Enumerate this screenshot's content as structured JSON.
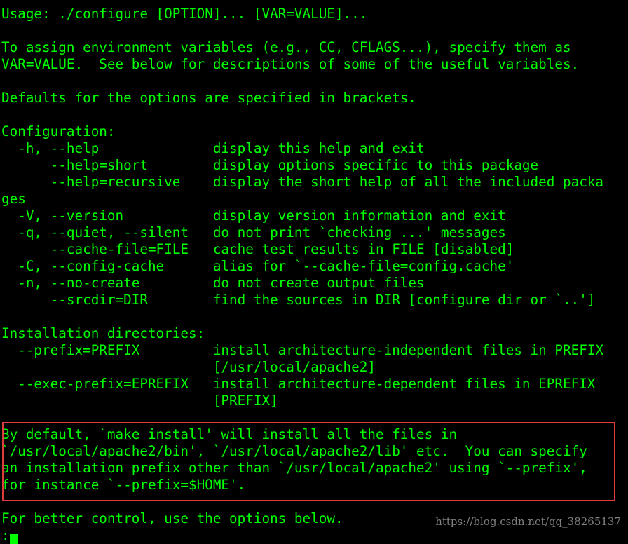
{
  "terminal": {
    "lines": [
      "Usage: ./configure [OPTION]... [VAR=VALUE]...",
      "",
      "To assign environment variables (e.g., CC, CFLAGS...), specify them as",
      "VAR=VALUE.  See below for descriptions of some of the useful variables.",
      "",
      "Defaults for the options are specified in brackets.",
      "",
      "Configuration:",
      "  -h, --help              display this help and exit",
      "      --help=short        display options specific to this package",
      "      --help=recursive    display the short help of all the included packa",
      "ges",
      "  -V, --version           display version information and exit",
      "  -q, --quiet, --silent   do not print `checking ...' messages",
      "      --cache-file=FILE   cache test results in FILE [disabled]",
      "  -C, --config-cache      alias for `--cache-file=config.cache'",
      "  -n, --no-create         do not create output files",
      "      --srcdir=DIR        find the sources in DIR [configure dir or `..']",
      "",
      "Installation directories:",
      "  --prefix=PREFIX         install architecture-independent files in PREFIX",
      "                          [/usr/local/apache2]",
      "  --exec-prefix=EPREFIX   install architecture-dependent files in EPREFIX",
      "                          [PREFIX]",
      "",
      "By default, `make install' will install all the files in",
      "`/usr/local/apache2/bin', `/usr/local/apache2/lib' etc.  You can specify",
      "an installation prefix other than `/usr/local/apache2' using `--prefix',",
      "for instance `--prefix=$HOME'.",
      "",
      "For better control, use the options below.",
      ":"
    ]
  },
  "colors": {
    "background": "#000000",
    "text": "#00ff00",
    "highlight_border": "#e03c3c",
    "watermark": "#7f7f7f"
  },
  "watermark": "https://blog.csdn.net/qq_38265137"
}
